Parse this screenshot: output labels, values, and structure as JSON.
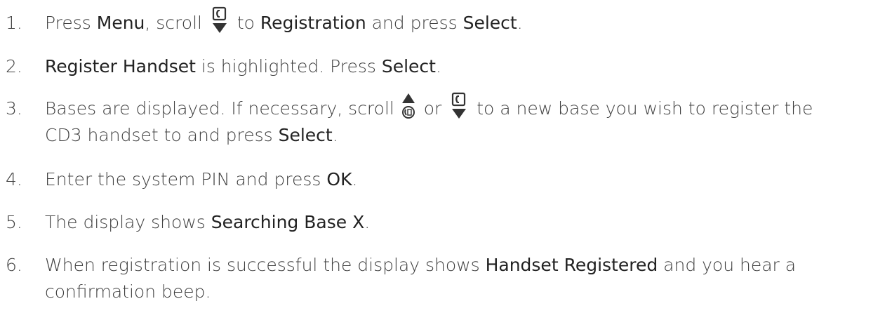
{
  "steps": [
    {
      "number": "1.",
      "t1": "Press ",
      "b1": "Menu",
      "t2": ", scroll ",
      "icon": "phone-down-icon",
      "t3": " to ",
      "b2": "Registration",
      "t4": " and press ",
      "b3": "Select",
      "t5": "."
    },
    {
      "number": "2.",
      "b1": "Register Handset",
      "t1": " is highlighted. Press ",
      "b2": "Select",
      "t2": "."
    },
    {
      "number": "3.",
      "t1": "Bases are displayed. If necessary, scroll ",
      "icon1": "up-redial-icon",
      "t2": " or ",
      "icon2": "phone-down-icon",
      "t3": " to a new base you wish to register the",
      "line2_t1": "CD3 handset to and press ",
      "line2_b1": "Select",
      "line2_t2": "."
    },
    {
      "number": "4.",
      "t1": "Enter the system PIN and press ",
      "b1": "OK",
      "t2": "."
    },
    {
      "number": "5.",
      "t1": "The display shows ",
      "b1": "Searching Base X",
      "t2": "."
    },
    {
      "number": "6.",
      "t1": "When registration is successful the display shows ",
      "b1": "Handset Registered",
      "t2": " and you hear a",
      "line2_t1": "confirmation beep."
    }
  ]
}
